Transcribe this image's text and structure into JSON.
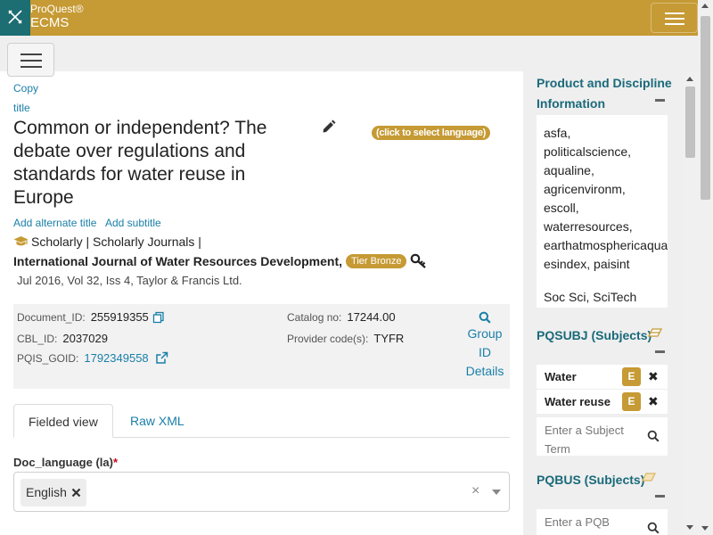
{
  "app": {
    "brand_super": "ProQuest®",
    "brand_name": "ECMS"
  },
  "record": {
    "copy_label": "Copy",
    "title_label": "title",
    "title": "Common or independent? The debate over regulations and standards for water reuse in Europe",
    "language_pill": "(click to select language)",
    "add_alternate_title": "Add alternate title",
    "add_subtitle": "Add subtitle",
    "pub_type": "Scholarly | Scholarly Journals |",
    "journal": "International Journal of Water Resources Development,",
    "tier": "Tier Bronze",
    "citation": "Jul 2016, Vol 32, Iss 4, Taylor & Francis Ltd."
  },
  "ids": {
    "document_id_label": "Document_ID:",
    "document_id": "255919355",
    "cbl_id_label": "CBL_ID:",
    "cbl_id": "2037029",
    "pqis_goid_label": "PQIS_GOID:",
    "pqis_goid": "1792349558",
    "catalog_no_label": "Catalog no:",
    "catalog_no": "17244.00",
    "provider_code_label": "Provider code(s):",
    "provider_code": "TYFR",
    "group_id_line1": "Group",
    "group_id_line2": "ID",
    "group_id_line3": "Details"
  },
  "tabs": {
    "fielded": "Fielded view",
    "raw": "Raw XML"
  },
  "doc_language": {
    "label": "Doc_language (la)",
    "required_mark": "*",
    "value": "English"
  },
  "right_panel": {
    "product_heading_line1": "Product and Discipline",
    "product_heading_line2": "Information",
    "disciplines": [
      "asfa,",
      "politicalscience,",
      "aqualine,",
      "agricenvironm,",
      "escoll,",
      "waterresources,",
      "earthatmosphericaquatic",
      "esindex,  paisint"
    ],
    "disciplines_footer": "Soc Sci,  SciTech",
    "pqsubj_heading": "PQSUBJ (Subjects)",
    "pqsubj_items": [
      {
        "label": "Water",
        "badge": "E"
      },
      {
        "label": "Water reuse",
        "badge": "E"
      }
    ],
    "pqsubj_placeholder": "Enter a Subject Term",
    "pqbus_heading": "PQBUS (Subjects)",
    "pqbus_placeholder": "Enter a PQB Subject Term"
  },
  "colors": {
    "brand_gold": "#c69a34",
    "brand_teal": "#1c6e73",
    "link": "#1a7fa8"
  },
  "icons": [
    "x-logo-icon",
    "hamburger-icon",
    "pencil-icon",
    "graduation-cap-icon",
    "key-icon",
    "copy-icon",
    "external-link-icon",
    "search-icon",
    "eraser-icon",
    "remove-x-icon"
  ]
}
